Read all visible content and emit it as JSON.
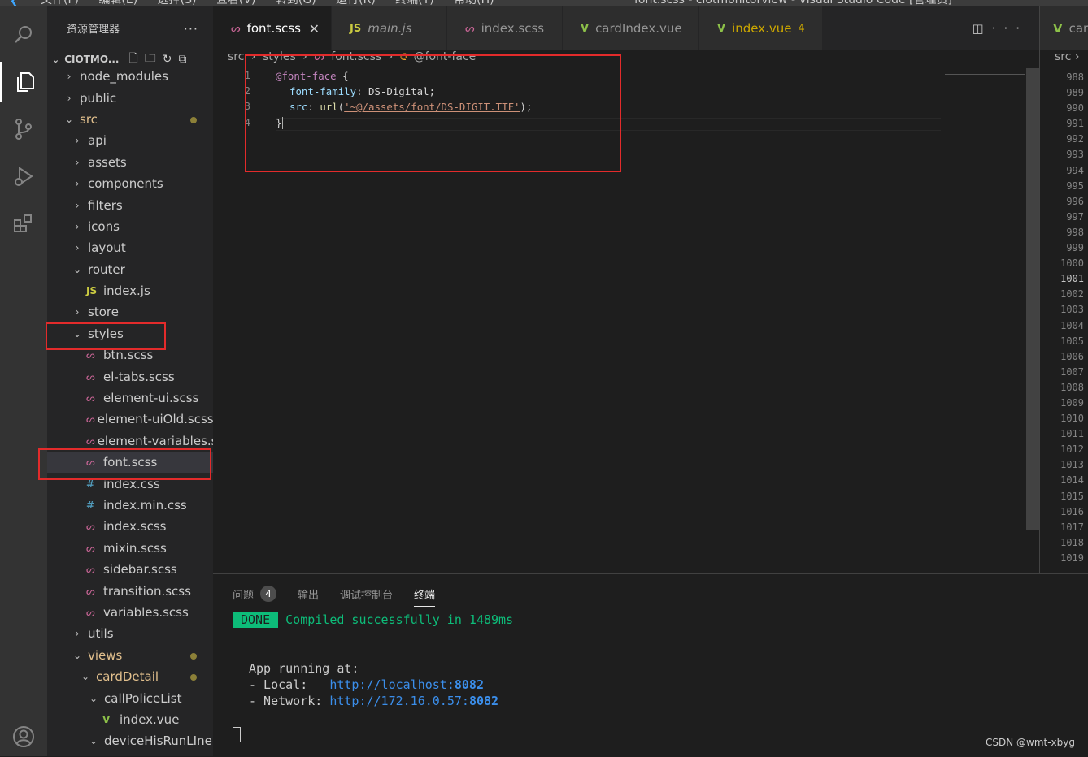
{
  "window": {
    "title": "font.scss - ciotmonitorview - Visual Studio Code [管理员]",
    "menu": [
      "文件(F)",
      "编辑(E)",
      "选择(S)",
      "查看(V)",
      "转到(G)",
      "运行(R)",
      "终端(T)",
      "帮助(H)"
    ]
  },
  "activity": [
    "search-icon",
    "explorer-icon",
    "source-control-icon",
    "run-debug-icon",
    "extensions-icon",
    "account-icon"
  ],
  "sidebar": {
    "title": "资源管理器",
    "more": "···",
    "project": "CIOTMO...",
    "tree": [
      {
        "label": "node_modules",
        "twisty": "›",
        "depth": 1
      },
      {
        "label": "public",
        "twisty": "›",
        "depth": 1
      },
      {
        "label": "src",
        "twisty": "⌄",
        "depth": 1,
        "modified": true
      },
      {
        "label": "api",
        "twisty": "›",
        "depth": 2
      },
      {
        "label": "assets",
        "twisty": "›",
        "depth": 2
      },
      {
        "label": "components",
        "twisty": "›",
        "depth": 2
      },
      {
        "label": "filters",
        "twisty": "›",
        "depth": 2
      },
      {
        "label": "icons",
        "twisty": "›",
        "depth": 2
      },
      {
        "label": "layout",
        "twisty": "›",
        "depth": 2
      },
      {
        "label": "router",
        "twisty": "⌄",
        "depth": 2
      },
      {
        "label": "index.js",
        "icon": "JS",
        "depth": 3
      },
      {
        "label": "store",
        "twisty": "›",
        "depth": 2
      },
      {
        "label": "styles",
        "twisty": "⌄",
        "depth": 2
      },
      {
        "label": "btn.scss",
        "icon": "sass",
        "depth": 3
      },
      {
        "label": "el-tabs.scss",
        "icon": "sass",
        "depth": 3
      },
      {
        "label": "element-ui.scss",
        "icon": "sass",
        "depth": 3
      },
      {
        "label": "element-uiOld.scss",
        "icon": "sass",
        "depth": 3
      },
      {
        "label": "element-variables.s...",
        "icon": "sass",
        "depth": 3
      },
      {
        "label": "font.scss",
        "icon": "sass",
        "depth": 3,
        "selected": true
      },
      {
        "label": "index.css",
        "icon": "#",
        "depth": 3
      },
      {
        "label": "index.min.css",
        "icon": "#",
        "depth": 3
      },
      {
        "label": "index.scss",
        "icon": "sass",
        "depth": 3
      },
      {
        "label": "mixin.scss",
        "icon": "sass",
        "depth": 3
      },
      {
        "label": "sidebar.scss",
        "icon": "sass",
        "depth": 3
      },
      {
        "label": "transition.scss",
        "icon": "sass",
        "depth": 3
      },
      {
        "label": "variables.scss",
        "icon": "sass",
        "depth": 3
      },
      {
        "label": "utils",
        "twisty": "›",
        "depth": 2
      },
      {
        "label": "views",
        "twisty": "⌄",
        "depth": 2,
        "modified": true
      },
      {
        "label": "cardDetail",
        "twisty": "⌄",
        "depth": 3,
        "modified": true
      },
      {
        "label": "callPoliceList",
        "twisty": "⌄",
        "depth": 4
      },
      {
        "label": "index.vue",
        "icon": "V",
        "depth": 5
      },
      {
        "label": "deviceHisRunLIne",
        "twisty": "⌄",
        "depth": 4
      }
    ]
  },
  "tabs": [
    {
      "label": "font.scss",
      "icon": "sass",
      "active": true,
      "close": "✕"
    },
    {
      "label": "main.js",
      "icon": "JS"
    },
    {
      "label": "index.scss",
      "icon": "sass"
    },
    {
      "label": "cardIndex.vue",
      "icon": "V"
    },
    {
      "label": "index.vue",
      "icon": "V",
      "badge": "4"
    }
  ],
  "breadcrumb": [
    "src",
    "styles",
    "font.scss",
    "@font-face"
  ],
  "editor": {
    "line_numbers": [
      "1",
      "2",
      "3",
      "4"
    ],
    "lines": [
      {
        "at": "@font-face",
        "rest": " {"
      },
      {
        "prop": "font-family",
        "rest": ": DS-Digital;"
      },
      {
        "prop": "src",
        "mid": ": ",
        "fn": "url",
        "str": "'~@/assets/font/DS-DIGIT.TTF'",
        "end": ");"
      },
      {
        "rest": "}"
      }
    ]
  },
  "split": {
    "tab": "car",
    "breadcrumb": "src ›",
    "line_numbers": [
      "988",
      "989",
      "990",
      "991",
      "992",
      "993",
      "994",
      "995",
      "996",
      "997",
      "998",
      "999",
      "1000",
      "1001",
      "1002",
      "1003",
      "1004",
      "1005",
      "1006",
      "1007",
      "1008",
      "1009",
      "1010",
      "1011",
      "1012",
      "1013",
      "1014",
      "1015",
      "1016",
      "1017",
      "1018",
      "1019"
    ],
    "current": "1001"
  },
  "panel": {
    "tabs": [
      {
        "label": "问题",
        "badge": "4"
      },
      {
        "label": "输出"
      },
      {
        "label": "调试控制台"
      },
      {
        "label": "终端",
        "active": true
      }
    ],
    "terminal": {
      "done": "DONE",
      "compiled": "Compiled successfully in 1489ms",
      "running": "App running at:",
      "local_label": "- Local:   ",
      "local_url": "http://localhost:",
      "local_port": "8082",
      "network_label": "- Network: ",
      "network_url": "http://172.16.0.57:",
      "network_port": "8082"
    }
  },
  "watermark": "CSDN @wmt-xbyg",
  "colors": {
    "annotation_box": "#e32b2b",
    "accent": "#0dbc79"
  }
}
